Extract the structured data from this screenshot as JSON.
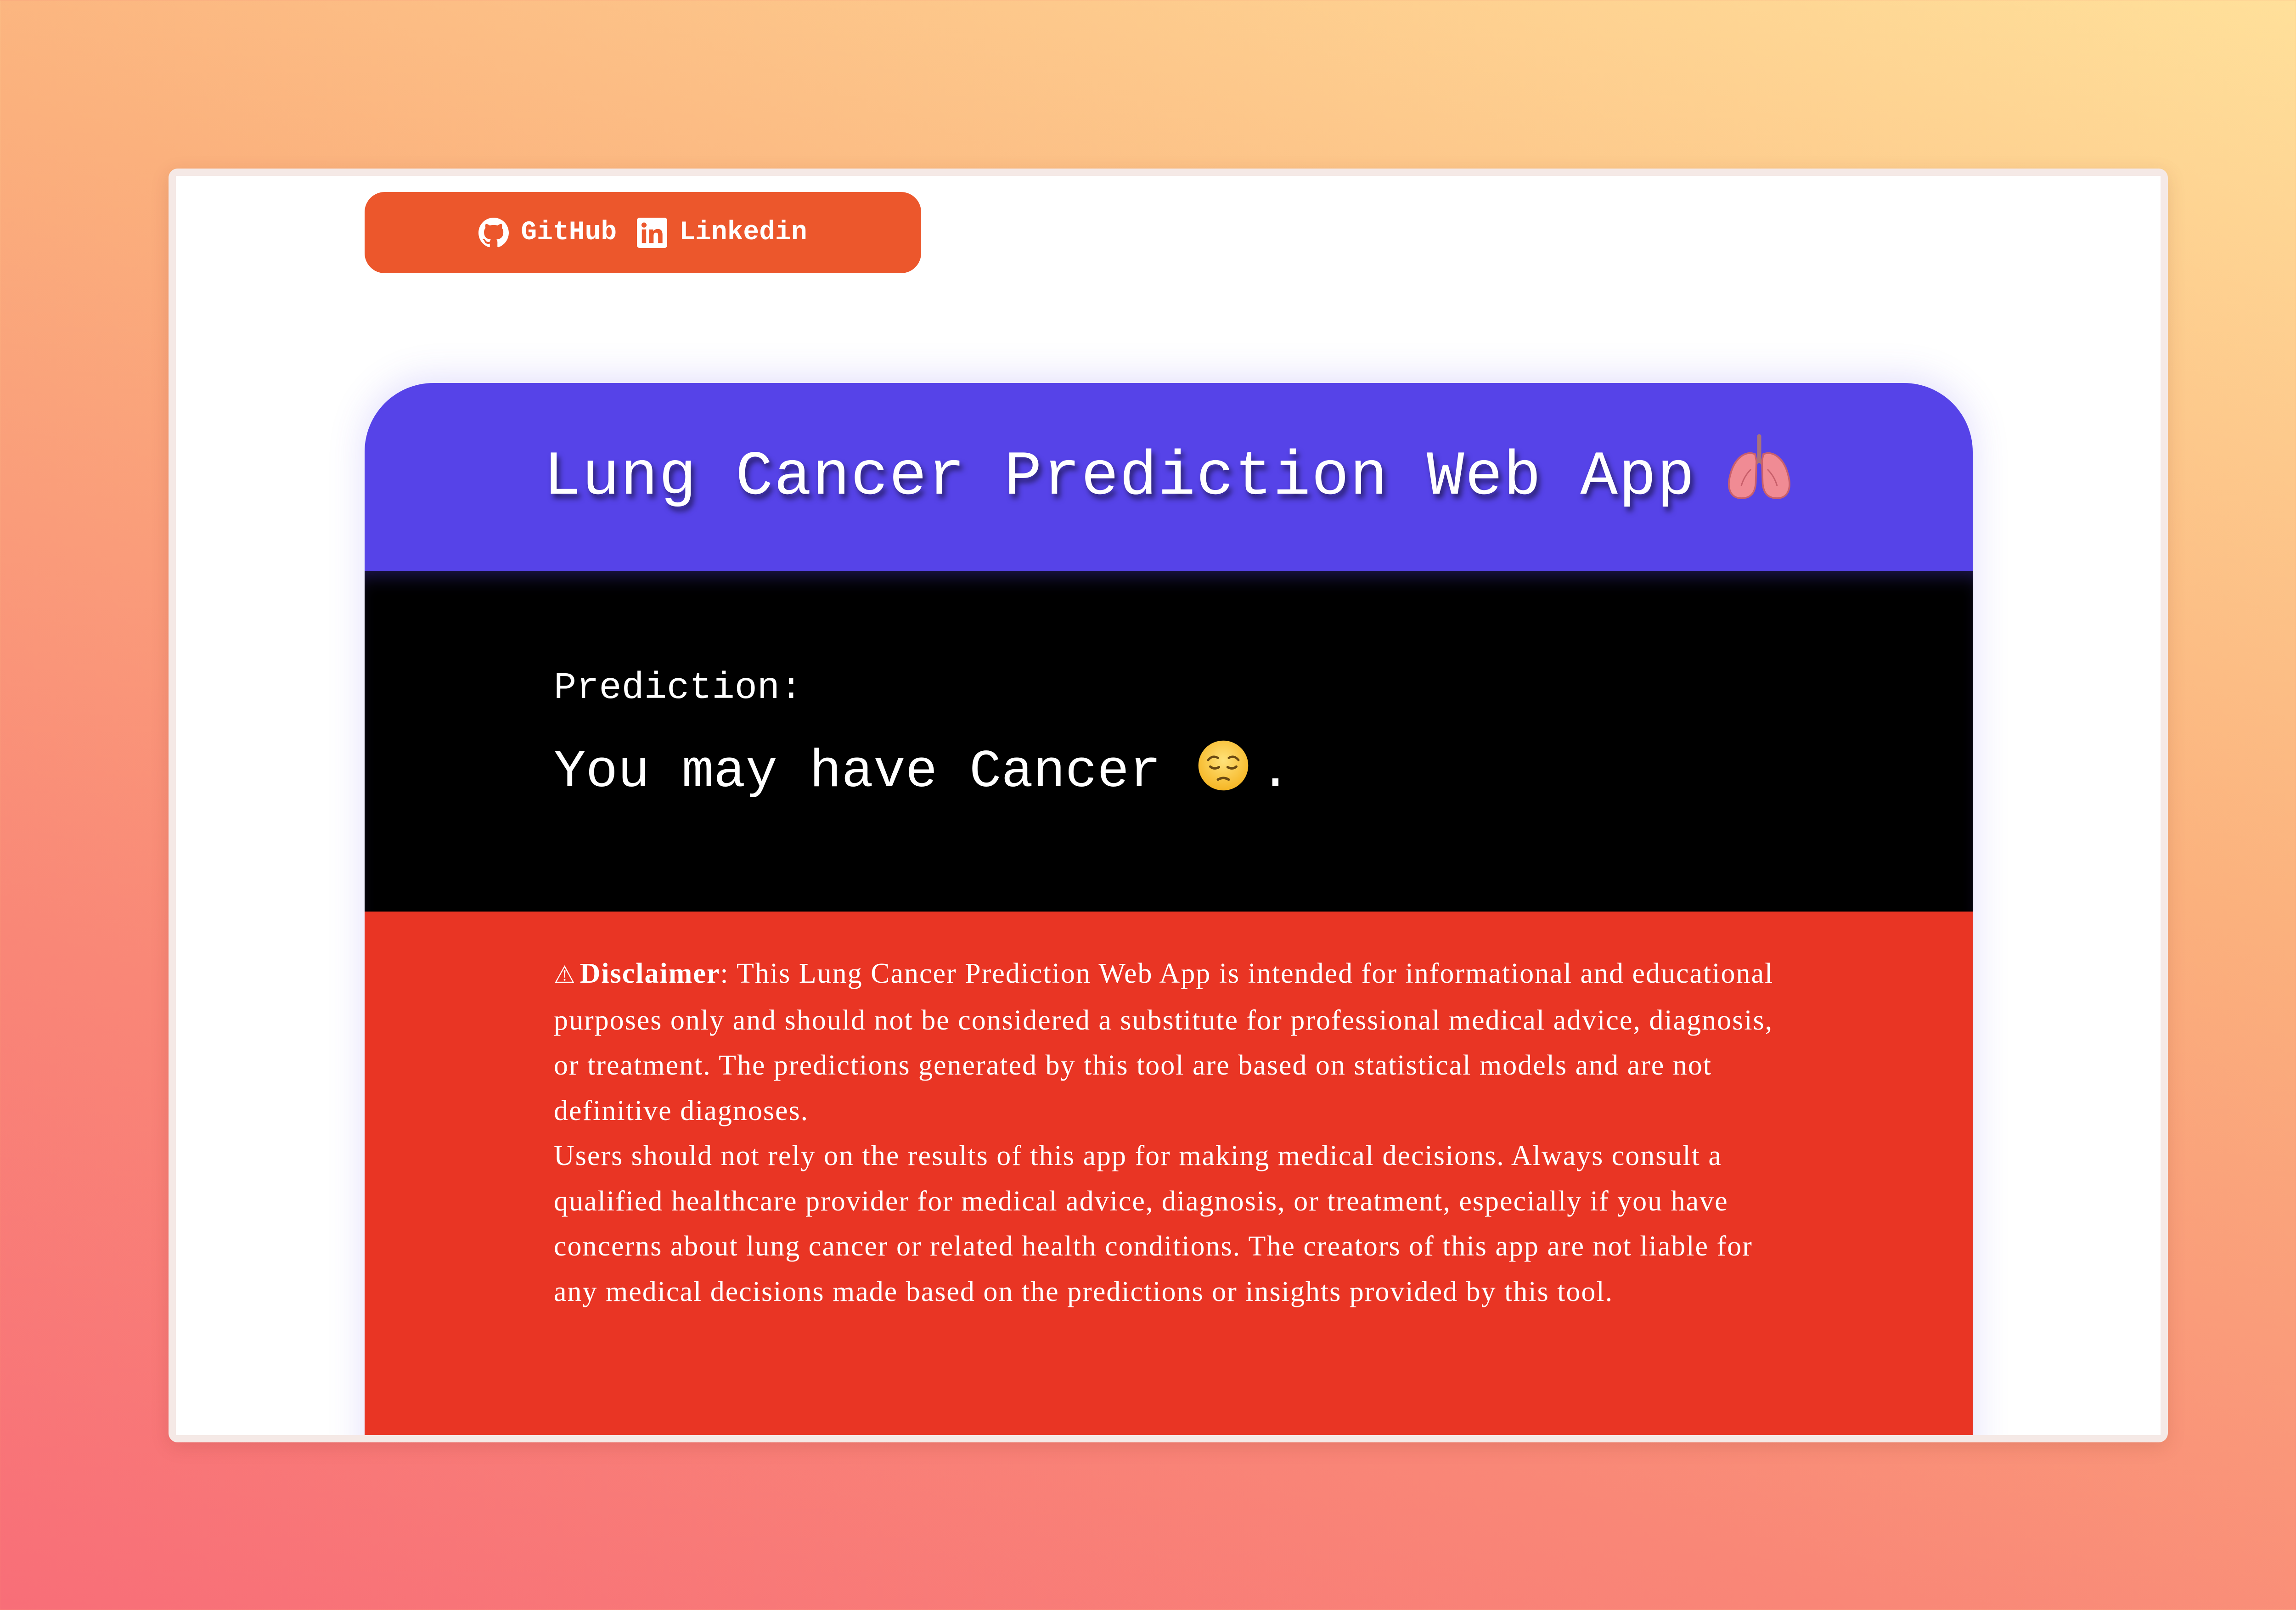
{
  "social": {
    "github_label": "GitHub",
    "linkedin_label": "Linkedin",
    "icons": [
      "github-icon",
      "linkedin-icon"
    ],
    "background_color": "#ec572c"
  },
  "header": {
    "title": "Lung Cancer Prediction Web App",
    "icon": "lungs-icon",
    "background_color": "#5643e8"
  },
  "prediction": {
    "label": "Prediction:",
    "result_text": "You may have Cancer",
    "result_icon": "sad-face-icon",
    "result_suffix": ".",
    "background_color": "#000000"
  },
  "disclaimer": {
    "warning_icon": "⚠",
    "title": "Disclaimer",
    "colon": ":",
    "paragraph1": "This Lung Cancer Prediction Web App is intended for informational and educational purposes only and should not be considered a substitute for professional medical advice, diagnosis, or treatment. The predictions generated by this tool are based on statistical models and are not definitive diagnoses.",
    "paragraph2": "Users should not rely on the results of this app for making medical decisions. Always consult a qualified healthcare provider for medical advice, diagnosis, or treatment, especially if you have concerns about lung cancer or related health conditions. The creators of this app are not liable for any medical decisions made based on the predictions or insights provided by this tool.",
    "background_color": "#e93524"
  }
}
